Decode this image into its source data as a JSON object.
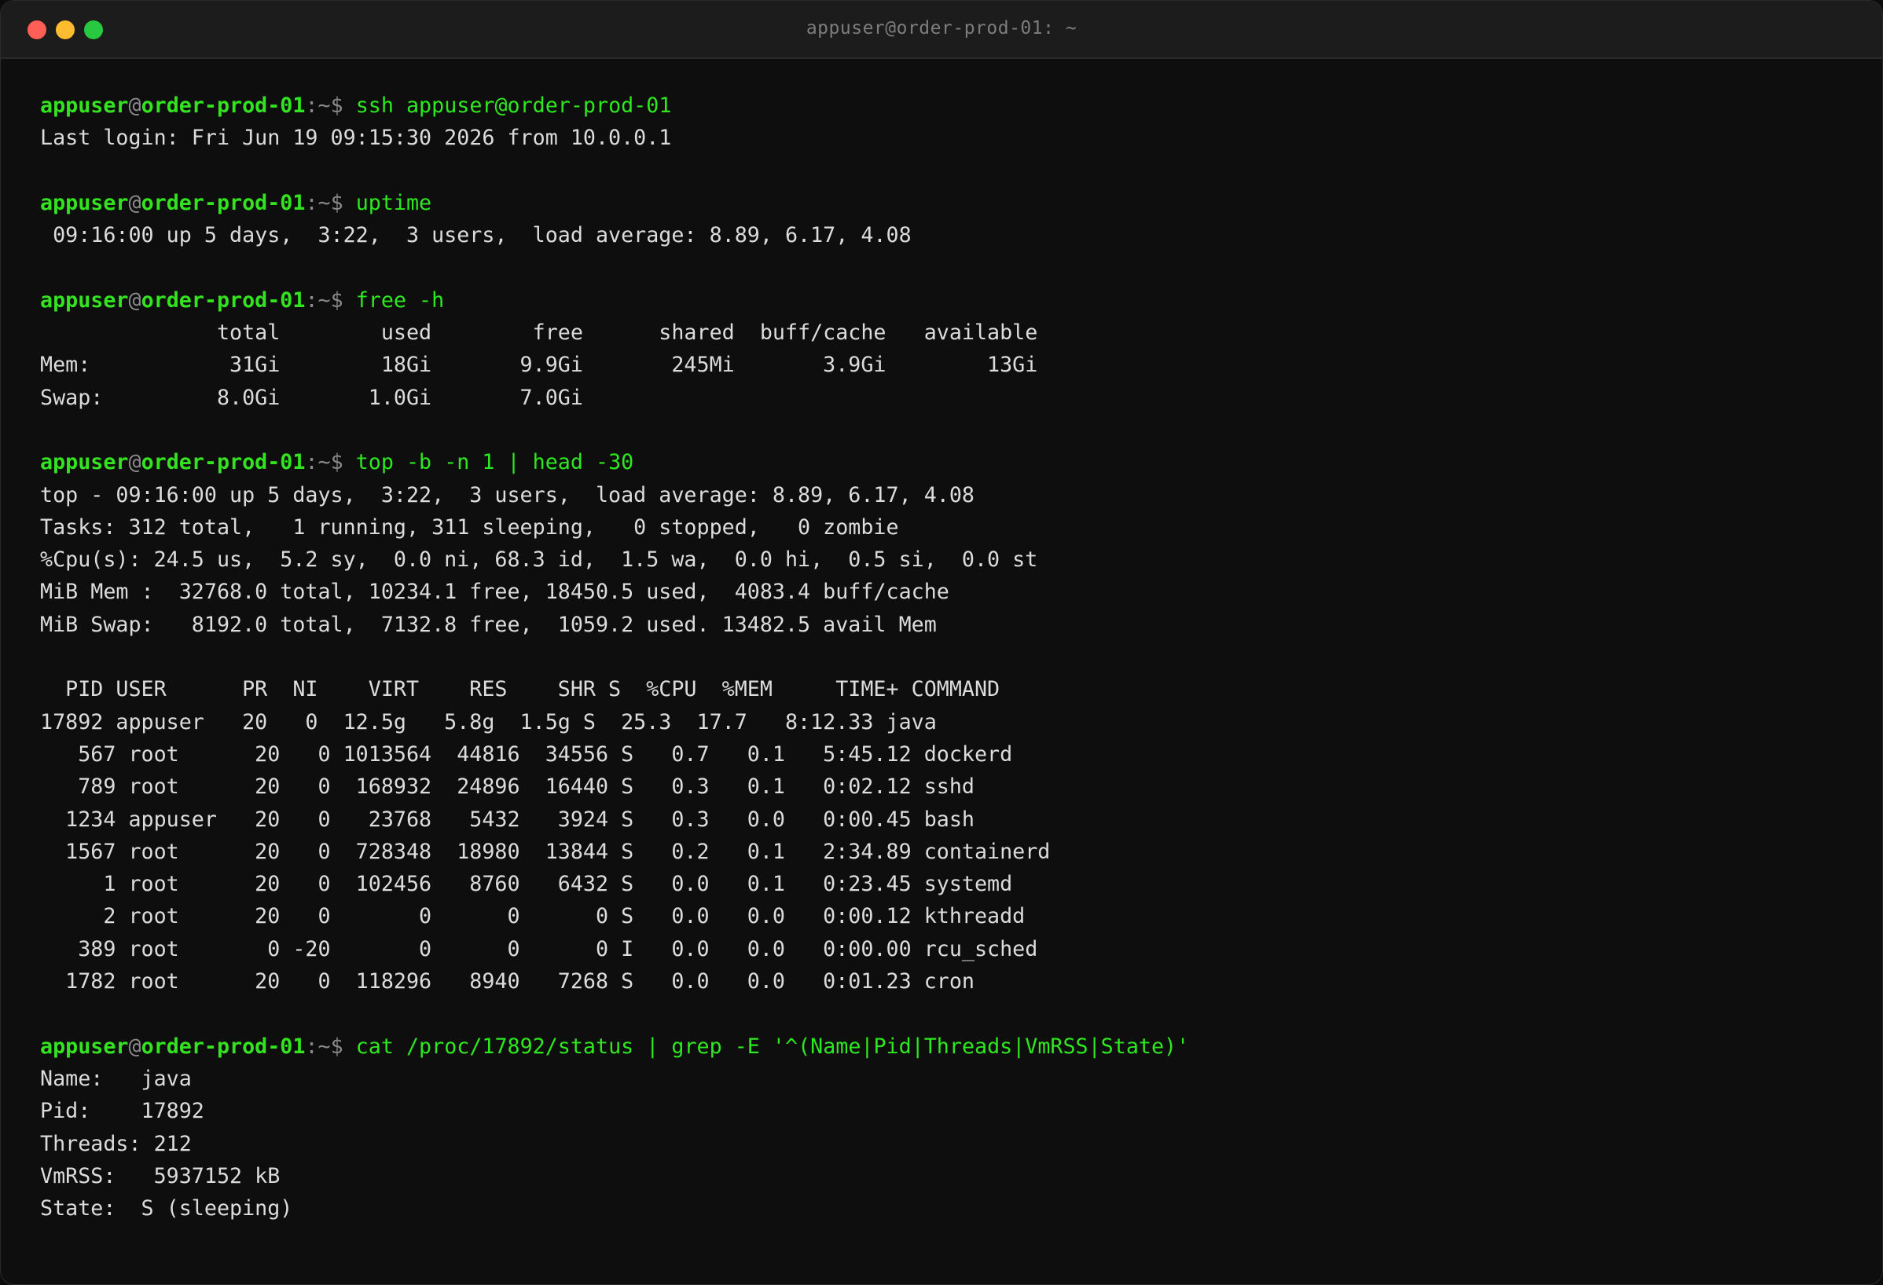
{
  "window": {
    "title": "appuser@order-prod-01: ~",
    "colors": {
      "background": "#0e0e0e",
      "titlebar": "#1c1c1c",
      "prompt": "#33e31f",
      "text": "#dcdcdc",
      "close": "#ff5f57",
      "minimize": "#febc2e",
      "maximize": "#28c840"
    }
  },
  "prompt": {
    "user": "appuser",
    "at": "@",
    "host": "order-prod-01",
    "suffix": ":~$ "
  },
  "blocks": [
    {
      "command": "ssh appuser@order-prod-01",
      "output": [
        "Last login: Fri Jun 19 09:15:30 2026 from 10.0.0.1"
      ]
    },
    {
      "command": "uptime",
      "output": [
        " 09:16:00 up 5 days,  3:22,  3 users,  load average: 8.89, 6.17, 4.08"
      ]
    },
    {
      "command": "free -h",
      "output": [
        "              total        used        free      shared  buff/cache   available",
        "Mem:           31Gi        18Gi       9.9Gi       245Mi       3.9Gi        13Gi",
        "Swap:         8.0Gi       1.0Gi       7.0Gi"
      ]
    },
    {
      "command": "top -b -n 1 | head -30",
      "output": [
        "top - 09:16:00 up 5 days,  3:22,  3 users,  load average: 8.89, 6.17, 4.08",
        "Tasks: 312 total,   1 running, 311 sleeping,   0 stopped,   0 zombie",
        "%Cpu(s): 24.5 us,  5.2 sy,  0.0 ni, 68.3 id,  1.5 wa,  0.0 hi,  0.5 si,  0.0 st",
        "MiB Mem :  32768.0 total, 10234.1 free, 18450.5 used,  4083.4 buff/cache",
        "MiB Swap:   8192.0 total,  7132.8 free,  1059.2 used. 13482.5 avail Mem",
        "",
        "  PID USER      PR  NI    VIRT    RES    SHR S  %CPU  %MEM     TIME+ COMMAND",
        "17892 appuser   20   0  12.5g   5.8g  1.5g S  25.3  17.7   8:12.33 java",
        "   567 root      20   0 1013564  44816  34556 S   0.7   0.1   5:45.12 dockerd",
        "   789 root      20   0  168932  24896  16440 S   0.3   0.1   0:02.12 sshd",
        "  1234 appuser   20   0   23768   5432   3924 S   0.3   0.0   0:00.45 bash",
        "  1567 root      20   0  728348  18980  13844 S   0.2   0.1   2:34.89 containerd",
        "     1 root      20   0  102456   8760   6432 S   0.0   0.1   0:23.45 systemd",
        "     2 root      20   0       0      0      0 S   0.0   0.0   0:00.12 kthreadd",
        "   389 root       0 -20       0      0      0 I   0.0   0.0   0:00.00 rcu_sched",
        "  1782 root      20   0  118296   8940   7268 S   0.0   0.0   0:01.23 cron"
      ]
    },
    {
      "command": "cat /proc/17892/status | grep -E '^(Name|Pid|Threads|VmRSS|State)'",
      "output": [
        "Name:   java",
        "Pid:    17892",
        "Threads: 212",
        "VmRSS:   5937152 kB",
        "State:  S (sleeping)"
      ]
    }
  ]
}
